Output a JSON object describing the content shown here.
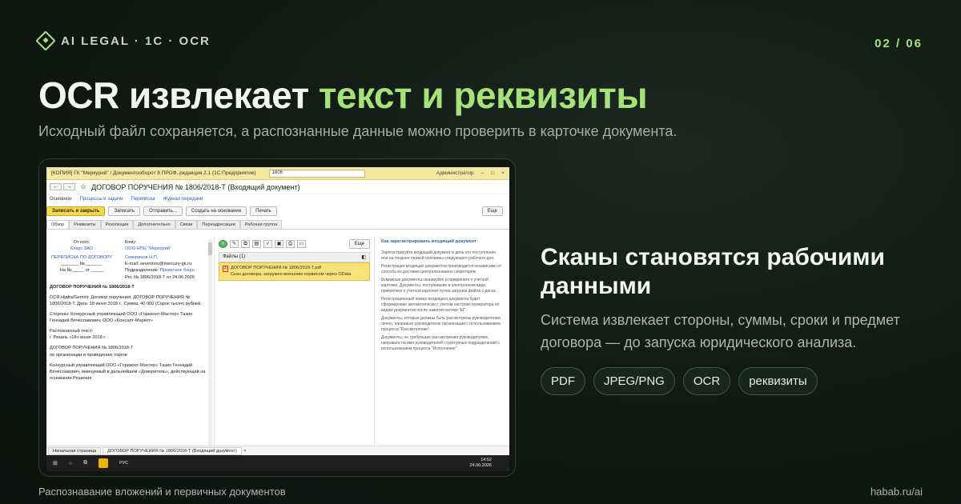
{
  "brand": "AI LEGAL · 1C · OCR",
  "pager": "02 / 06",
  "headline": {
    "part1": "OCR извлекает ",
    "accent": "текст и реквизиты"
  },
  "subtitle": "Исходный файл сохраняется, а распознанные данные можно проверить в карточке документа.",
  "screenshot": {
    "window_title": "[КОПИЯ] ГК \"Меркурий\" / Документооборот 8 ПРОФ, редакция 2.1 (1С:Предприятие)",
    "search_value": "1806",
    "user": "Администратор",
    "doc_title": "ДОГОВОР ПОРУЧЕНИЯ № 1806/2018-Т (Входящий документ)",
    "links": [
      "Основное",
      "Процессы и задачи",
      "Переписка",
      "Журнал передачи"
    ],
    "toolbar": {
      "save_close": "Записать и закрыть",
      "save": "Записать",
      "send": "Отправить...",
      "create_based": "Создать на основании",
      "print": "Печать",
      "more": "Еще"
    },
    "tabs": [
      "Обзор",
      "Реквизиты",
      "Резолюции",
      "Дополнительно",
      "Связи",
      "Переадресации",
      "Рабочая группа"
    ],
    "left": {
      "from_label": "От кого:",
      "from_value": "Клаус ЗАО",
      "to_label": "Кому:",
      "to_value": "ООО НПЦ \"Меркурий\"",
      "correspondence": "ПЕРЕПИСКА ПО ДОГОВОРУ",
      "number_line": "_______ №_______",
      "in_no": "На №_____ от _____",
      "person": "Северинов Н.П.",
      "email": "E-mail: severinov@mercury-gk.ru",
      "dept_label": "Подразделение:",
      "dept_value": "Проектное бюро",
      "reg": "Рег. № 1806/2018-Т от 24.06.2026",
      "heading": "ДОГОВОР ПОРУЧЕНИЯ № 1806/2018-Т",
      "ocr_line": "OCR Hydra/Gemini: Договор поручения. ДОГОВОР ПОРУЧЕНИЯ № 1806/2018-Т. Дата: 18 июня 2018 г.. Сумма: 40 000 (Сорок тысяч) рублей.",
      "parties": "Стороны: Конкурсный управляющий ООО «Горизонт-Мастер» Тазин Геннадий Вячеславович; ООО «Консалт-Маркет»",
      "recognized_label": "Распознанный текст:",
      "recognized_line": "г. Рязань «18» июня 2018 г.",
      "recog_heading": "ДОГОВОР ПОРУЧЕНИЯ № 1806/2018-Т",
      "recog_sub": "по организации и проведению торгов",
      "recog_body": "Конкурсный управляющий ООО «Горизонт-Мастер» Тазин Геннадий Вячеславович, именуемый в дальнейшем «Доверитель», действующий на основании Решения"
    },
    "mid": {
      "more": "Еще",
      "files_head": "Файлы (1)",
      "file_name": "ДОГОВОР ПОРУЧЕНИЯ № 1806/2018-Т.pdf",
      "file_desc": "Скан договора, загружен внешним сервисом через OData"
    },
    "right": {
      "title": "Как зарегистрировать входящий документ",
      "paras": [
        "Зарегистрируйте входящий документ в день его поступления или на позднее первой половины следующего рабочего дня.",
        "Регистрация входящих документов производится независимо от способа их доставки централизованно секретарем.",
        "Бумажные документы сканируйте и прикрепите к учетной карточке. Документы, поступившие в электронном виде, прикрепите к учетной карточке путем загрузки файла с диска.",
        "Регистрационный номер входящего документа будет сформирован автоматически с учетом настроек нумератора по видам документов после нажатия кнопки \"Ы\".",
        "Документы, которые должны быть рассмотрены руководителем лично, направьте руководителю организации с использованием процесса \"Рассмотрение\".",
        "Документы, не требующие рассмотрения руководителем, направьте на имя руководителей структурных подразделений с использованием процесса \"Исполнение\"."
      ]
    },
    "bottom_tabs": [
      "Начальная страница",
      "ДОГОВОР ПОРУЧЕНИЯ № 1806/2018-Т (Входящий документ)"
    ],
    "taskbar": {
      "lang": "РУС",
      "time": "14:52",
      "date": "24.06.2026"
    }
  },
  "right_heading": "Сканы становятся рабочими данными",
  "right_desc": "Система извлекает стороны, суммы, сроки и предмет договора — до запуска юридического анализа.",
  "chips": [
    "PDF",
    "JPEG/PNG",
    "OCR",
    "реквизиты"
  ],
  "footer_left": "Распознавание вложений и первичных документов",
  "footer_right": "habab.ru/ai"
}
